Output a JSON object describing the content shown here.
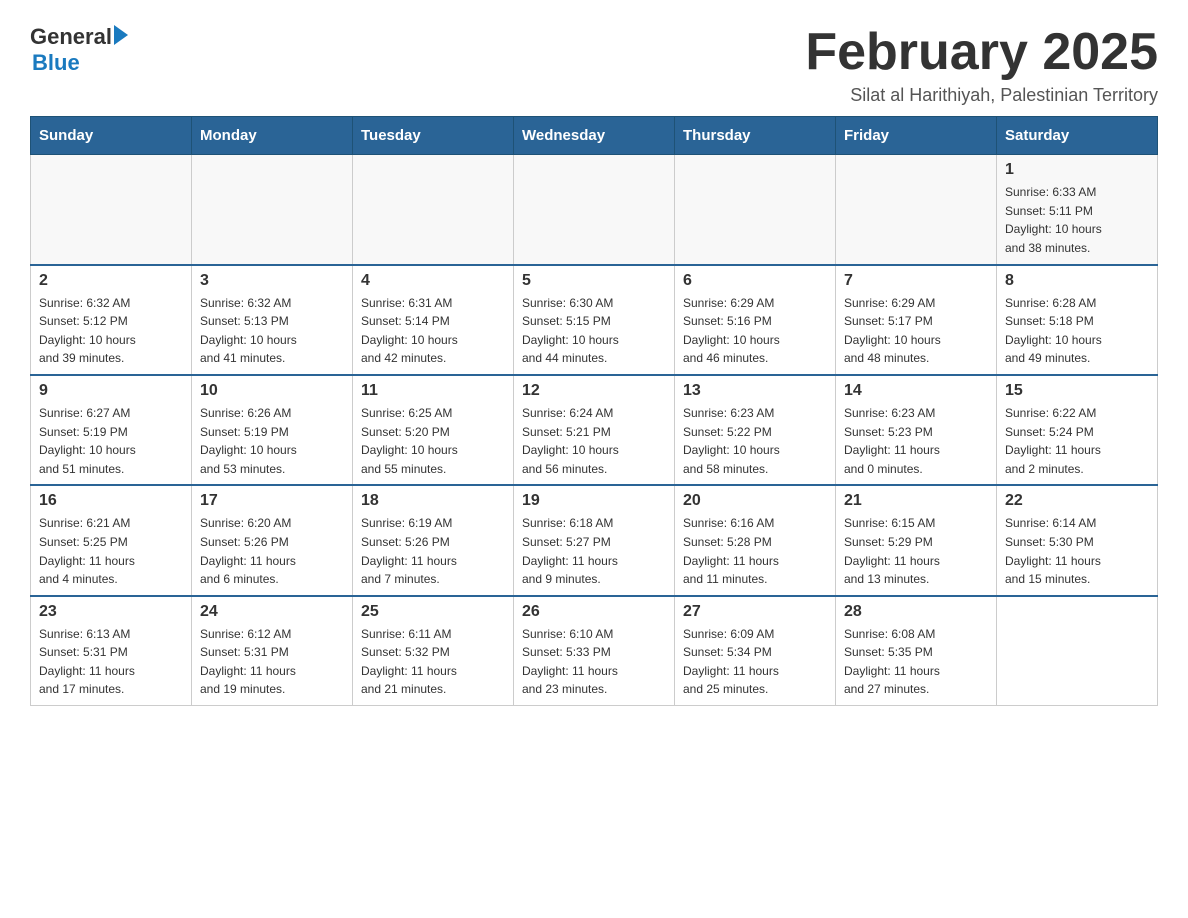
{
  "header": {
    "logo_general": "General",
    "logo_blue": "Blue",
    "title": "February 2025",
    "subtitle": "Silat al Harithiyah, Palestinian Territory"
  },
  "calendar": {
    "days_of_week": [
      "Sunday",
      "Monday",
      "Tuesday",
      "Wednesday",
      "Thursday",
      "Friday",
      "Saturday"
    ],
    "weeks": [
      [
        {
          "day": "",
          "info": ""
        },
        {
          "day": "",
          "info": ""
        },
        {
          "day": "",
          "info": ""
        },
        {
          "day": "",
          "info": ""
        },
        {
          "day": "",
          "info": ""
        },
        {
          "day": "",
          "info": ""
        },
        {
          "day": "1",
          "info": "Sunrise: 6:33 AM\nSunset: 5:11 PM\nDaylight: 10 hours\nand 38 minutes."
        }
      ],
      [
        {
          "day": "2",
          "info": "Sunrise: 6:32 AM\nSunset: 5:12 PM\nDaylight: 10 hours\nand 39 minutes."
        },
        {
          "day": "3",
          "info": "Sunrise: 6:32 AM\nSunset: 5:13 PM\nDaylight: 10 hours\nand 41 minutes."
        },
        {
          "day": "4",
          "info": "Sunrise: 6:31 AM\nSunset: 5:14 PM\nDaylight: 10 hours\nand 42 minutes."
        },
        {
          "day": "5",
          "info": "Sunrise: 6:30 AM\nSunset: 5:15 PM\nDaylight: 10 hours\nand 44 minutes."
        },
        {
          "day": "6",
          "info": "Sunrise: 6:29 AM\nSunset: 5:16 PM\nDaylight: 10 hours\nand 46 minutes."
        },
        {
          "day": "7",
          "info": "Sunrise: 6:29 AM\nSunset: 5:17 PM\nDaylight: 10 hours\nand 48 minutes."
        },
        {
          "day": "8",
          "info": "Sunrise: 6:28 AM\nSunset: 5:18 PM\nDaylight: 10 hours\nand 49 minutes."
        }
      ],
      [
        {
          "day": "9",
          "info": "Sunrise: 6:27 AM\nSunset: 5:19 PM\nDaylight: 10 hours\nand 51 minutes."
        },
        {
          "day": "10",
          "info": "Sunrise: 6:26 AM\nSunset: 5:19 PM\nDaylight: 10 hours\nand 53 minutes."
        },
        {
          "day": "11",
          "info": "Sunrise: 6:25 AM\nSunset: 5:20 PM\nDaylight: 10 hours\nand 55 minutes."
        },
        {
          "day": "12",
          "info": "Sunrise: 6:24 AM\nSunset: 5:21 PM\nDaylight: 10 hours\nand 56 minutes."
        },
        {
          "day": "13",
          "info": "Sunrise: 6:23 AM\nSunset: 5:22 PM\nDaylight: 10 hours\nand 58 minutes."
        },
        {
          "day": "14",
          "info": "Sunrise: 6:23 AM\nSunset: 5:23 PM\nDaylight: 11 hours\nand 0 minutes."
        },
        {
          "day": "15",
          "info": "Sunrise: 6:22 AM\nSunset: 5:24 PM\nDaylight: 11 hours\nand 2 minutes."
        }
      ],
      [
        {
          "day": "16",
          "info": "Sunrise: 6:21 AM\nSunset: 5:25 PM\nDaylight: 11 hours\nand 4 minutes."
        },
        {
          "day": "17",
          "info": "Sunrise: 6:20 AM\nSunset: 5:26 PM\nDaylight: 11 hours\nand 6 minutes."
        },
        {
          "day": "18",
          "info": "Sunrise: 6:19 AM\nSunset: 5:26 PM\nDaylight: 11 hours\nand 7 minutes."
        },
        {
          "day": "19",
          "info": "Sunrise: 6:18 AM\nSunset: 5:27 PM\nDaylight: 11 hours\nand 9 minutes."
        },
        {
          "day": "20",
          "info": "Sunrise: 6:16 AM\nSunset: 5:28 PM\nDaylight: 11 hours\nand 11 minutes."
        },
        {
          "day": "21",
          "info": "Sunrise: 6:15 AM\nSunset: 5:29 PM\nDaylight: 11 hours\nand 13 minutes."
        },
        {
          "day": "22",
          "info": "Sunrise: 6:14 AM\nSunset: 5:30 PM\nDaylight: 11 hours\nand 15 minutes."
        }
      ],
      [
        {
          "day": "23",
          "info": "Sunrise: 6:13 AM\nSunset: 5:31 PM\nDaylight: 11 hours\nand 17 minutes."
        },
        {
          "day": "24",
          "info": "Sunrise: 6:12 AM\nSunset: 5:31 PM\nDaylight: 11 hours\nand 19 minutes."
        },
        {
          "day": "25",
          "info": "Sunrise: 6:11 AM\nSunset: 5:32 PM\nDaylight: 11 hours\nand 21 minutes."
        },
        {
          "day": "26",
          "info": "Sunrise: 6:10 AM\nSunset: 5:33 PM\nDaylight: 11 hours\nand 23 minutes."
        },
        {
          "day": "27",
          "info": "Sunrise: 6:09 AM\nSunset: 5:34 PM\nDaylight: 11 hours\nand 25 minutes."
        },
        {
          "day": "28",
          "info": "Sunrise: 6:08 AM\nSunset: 5:35 PM\nDaylight: 11 hours\nand 27 minutes."
        },
        {
          "day": "",
          "info": ""
        }
      ]
    ]
  }
}
